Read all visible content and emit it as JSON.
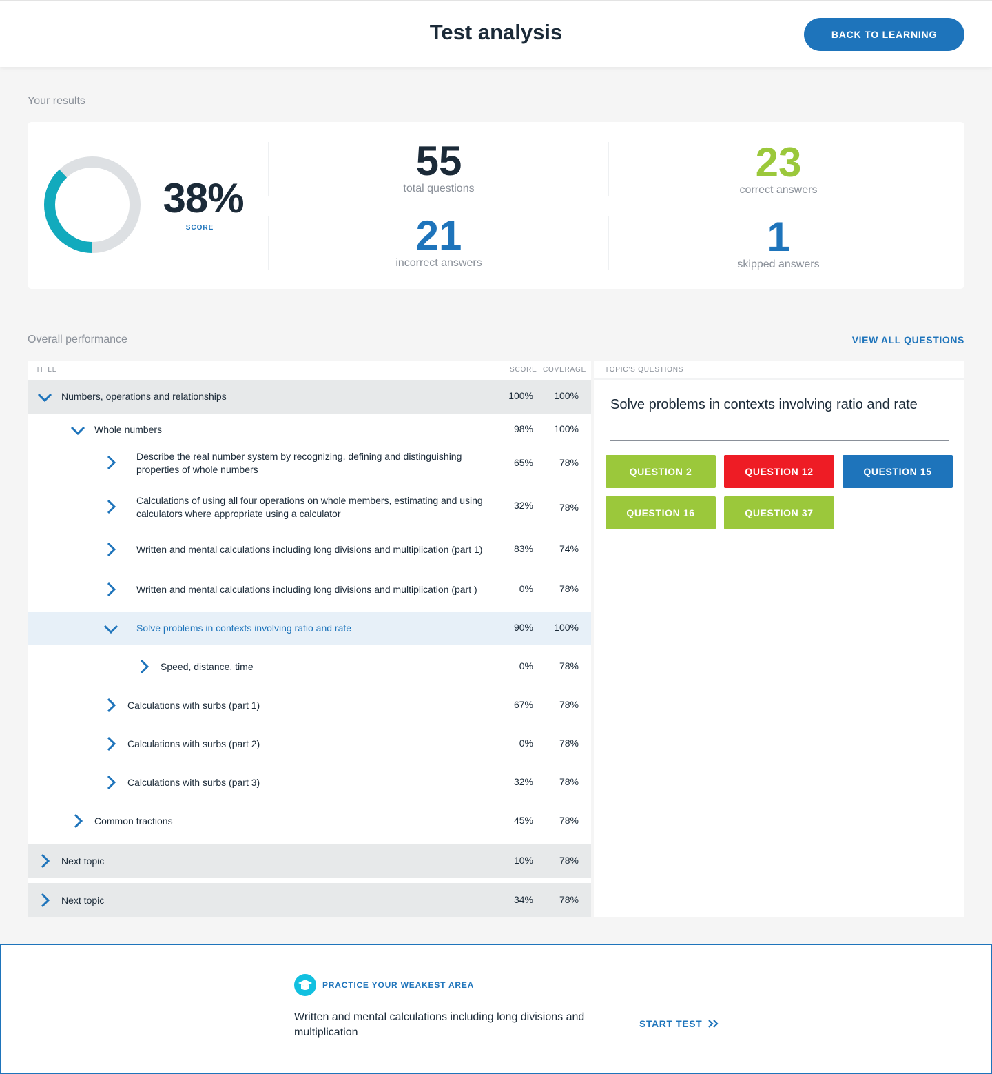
{
  "header": {
    "title": "Test analysis",
    "back_label": "BACK TO LEARNING"
  },
  "results": {
    "section_label": "Your results",
    "score_value": "38%",
    "score_fraction": 0.38,
    "score_label": "SCORE",
    "total": {
      "value": "55",
      "label": "total questions"
    },
    "correct": {
      "value": "23",
      "label": "correct answers"
    },
    "incorrect": {
      "value": "21",
      "label": "incorrect answers"
    },
    "skipped": {
      "value": "1",
      "label": "skipped answers"
    }
  },
  "performance": {
    "section_label": "Overall performance",
    "view_all": "VIEW ALL QUESTIONS",
    "columns": {
      "title": "TITLE",
      "score": "SCORE",
      "coverage": "COVERAGE",
      "topic_questions": "TOPIC'S QUESTIONS"
    },
    "rows": [
      {
        "label": "Numbers, operations and relationships",
        "score": "100%",
        "coverage": "100%"
      },
      {
        "label": "Whole numbers",
        "score": "98%",
        "coverage": "100%"
      },
      {
        "label": "Describe the real number system by recognizing, defining and distinguishing properties of whole numbers",
        "score": "65%",
        "coverage": "78%"
      },
      {
        "label": "Calculations of using all four operations on whole members, estimating and using calculators where appropriate using a calculator",
        "score": "32%",
        "coverage": "78%"
      },
      {
        "label": "Written and mental calculations including long divisions and multiplication (part 1)",
        "score": "83%",
        "coverage": "74%"
      },
      {
        "label": "Written and mental calculations including long divisions and multiplication (part )",
        "score": "0%",
        "coverage": "78%"
      },
      {
        "label": "Solve problems in contexts involving ratio and rate",
        "score": "90%",
        "coverage": "100%"
      },
      {
        "label": "Speed, distance, time",
        "score": "0%",
        "coverage": "78%"
      },
      {
        "label": "Calculations with surbs (part 1)",
        "score": "67%",
        "coverage": "78%"
      },
      {
        "label": "Calculations with surbs (part 2)",
        "score": "0%",
        "coverage": "78%"
      },
      {
        "label": "Calculations with surbs (part 3)",
        "score": "32%",
        "coverage": "78%"
      },
      {
        "label": "Common fractions",
        "score": "45%",
        "coverage": "78%"
      },
      {
        "label": "Next topic",
        "score": "10%",
        "coverage": "78%"
      },
      {
        "label": "Next topic",
        "score": "34%",
        "coverage": "78%"
      }
    ]
  },
  "topic_panel": {
    "title": "Solve problems in contexts involving ratio and rate",
    "questions": [
      {
        "label": "QUESTION 2",
        "status": "correct"
      },
      {
        "label": "QUESTION 12",
        "status": "incorrect"
      },
      {
        "label": "QUESTION 15",
        "status": "skipped"
      },
      {
        "label": "QUESTION 16",
        "status": "correct"
      },
      {
        "label": "QUESTION 37",
        "status": "correct"
      }
    ]
  },
  "practice": {
    "title": "PRACTICE YOUR WEAKEST AREA",
    "description": "Written and mental calculations including long divisions and multiplication",
    "start_label": "START TEST"
  },
  "colors": {
    "accent": "#1e74bb",
    "correct": "#9bc83b",
    "incorrect": "#ee1c25",
    "donut": "#12aabd",
    "dark": "#1b2a38"
  }
}
